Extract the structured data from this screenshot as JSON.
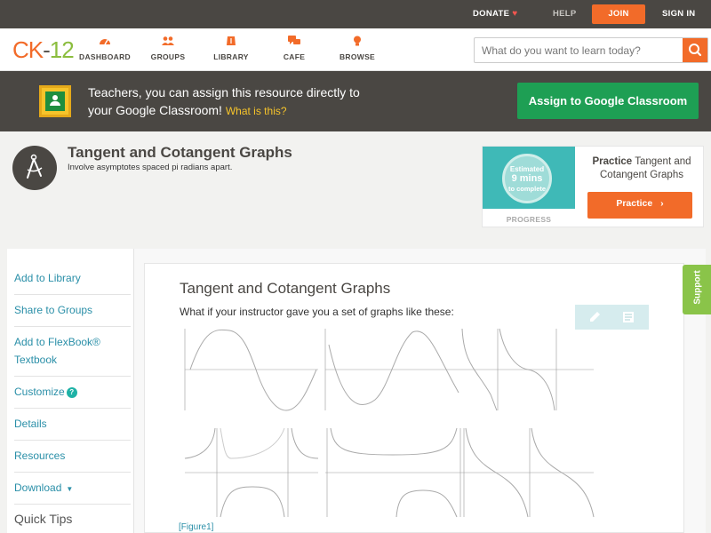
{
  "topbar": {
    "donate": "DONATE",
    "help": "HELP",
    "join": "JOIN",
    "signin": "SIGN IN"
  },
  "nav": {
    "logo": {
      "ck": "CK",
      "num": "12"
    },
    "items": [
      {
        "label": "DASHBOARD",
        "icon": "dashboard-icon"
      },
      {
        "label": "GROUPS",
        "icon": "groups-icon"
      },
      {
        "label": "LIBRARY",
        "icon": "library-icon"
      },
      {
        "label": "CAFE",
        "icon": "cafe-icon"
      },
      {
        "label": "BROWSE",
        "icon": "browse-icon"
      }
    ],
    "search_placeholder": "What do you want to learn today?"
  },
  "classroom_banner": {
    "line1": "Teachers, you can assign this resource directly to",
    "line2": "your Google Classroom!",
    "whatis": "What is this?",
    "button": "Assign to Google Classroom"
  },
  "concept": {
    "title": "Tangent and Cotangent Graphs",
    "subtitle": "Involve asymptotes spaced pi radians apart."
  },
  "progress": {
    "estimated": "Estimated",
    "mins": "9 mins",
    "to_complete": "to complete",
    "label": "PROGRESS",
    "practice_bold": "Practice",
    "practice_rest": "Tangent and Cotangent Graphs",
    "practice_button": "Practice"
  },
  "sidebar": {
    "items": [
      "Add to Library",
      "Share to Groups",
      "Add to FlexBook®",
      "Textbook",
      "Customize",
      "Details",
      "Resources",
      "Download",
      "Quick Tips"
    ]
  },
  "main": {
    "title": "Tangent and Cotangent Graphs",
    "question": "What if your instructor gave you a set of graphs like these:",
    "figure_link": "[Figure1]"
  },
  "support": "Support",
  "colors": {
    "orange": "#f26b29",
    "dark": "#4a4743",
    "green": "#1e9f54",
    "teal_link": "#2a8fa8",
    "support_green": "#8ac449"
  }
}
